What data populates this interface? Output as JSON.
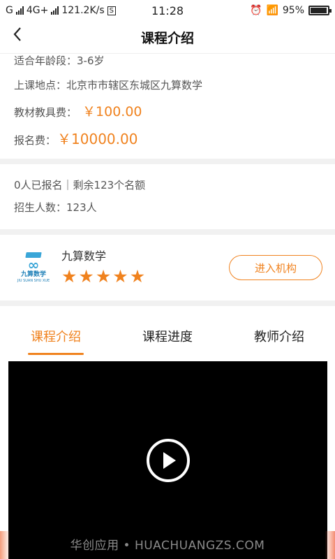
{
  "status_bar": {
    "carrier": "G",
    "network": "4G+",
    "speed": "121.2K/s",
    "s_box": "S",
    "time": "11:28",
    "battery": "95%",
    "battery_level": 0.95
  },
  "nav": {
    "back_icon": "chevron-left-icon",
    "title": "课程介绍"
  },
  "course_info": {
    "age_label": "适合年龄段：",
    "age_value": "3-6岁",
    "location_label": "上课地点：",
    "location_value": "北京市市辖区东城区九算数学",
    "material_label": "教材教具费：",
    "material_value": "￥100.00",
    "fee_label": "报名费：",
    "fee_value": "￥10000.00"
  },
  "enrollment": {
    "status": "0人已报名｜剩余123个名额",
    "quota_label": "招生人数：",
    "quota_value": "123人"
  },
  "org": {
    "name": "九算数学",
    "logo_text": "九算数学",
    "logo_sub": "JIU SUAN SHU XUE",
    "rating": 5,
    "enter_label": "进入机构"
  },
  "tabs": [
    {
      "label": "课程介绍",
      "active": true
    },
    {
      "label": "课程进度",
      "active": false
    },
    {
      "label": "教师介绍",
      "active": false
    }
  ],
  "video": {
    "play_icon": "play-icon"
  },
  "watermark": "华创应用 • HUACHUANGZS.COM",
  "colors": {
    "accent": "#f0821e",
    "logo_blue": "#3aa6d8"
  }
}
